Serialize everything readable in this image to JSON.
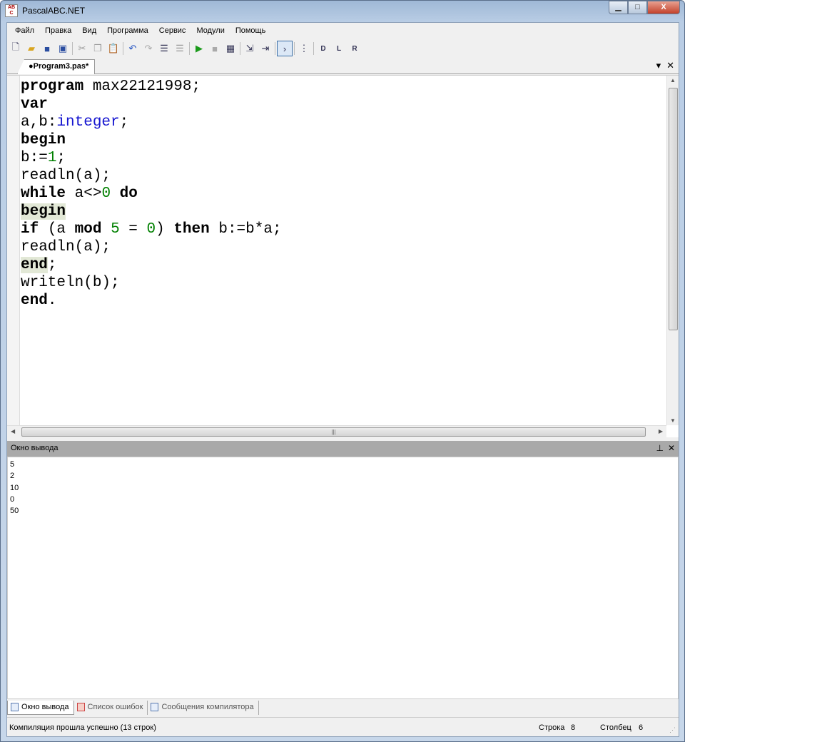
{
  "window": {
    "title": "PascalABC.NET",
    "min": "▁",
    "max": "□",
    "close": "X"
  },
  "menu": [
    "Файл",
    "Правка",
    "Вид",
    "Программа",
    "Сервис",
    "Модули",
    "Помощь"
  ],
  "tab": {
    "label": "●Program3.pas*",
    "dropdown": "▾",
    "close": "✕"
  },
  "code": [
    [
      [
        "program",
        "k"
      ],
      [
        " max22121998;",
        ""
      ]
    ],
    [
      [
        "var",
        "k"
      ]
    ],
    [
      [
        "a,b:",
        ""
      ],
      [
        "integer",
        "ty"
      ],
      [
        ";",
        ""
      ]
    ],
    [
      [
        "begin",
        "k"
      ]
    ],
    [
      [
        "b:=",
        ""
      ],
      [
        "1",
        "n"
      ],
      [
        ";",
        ""
      ]
    ],
    [
      [
        "readln(a);",
        ""
      ]
    ],
    [
      [
        "while",
        "k"
      ],
      [
        " a<>",
        ""
      ],
      [
        "0",
        "n"
      ],
      [
        " ",
        ""
      ],
      [
        "do",
        "k"
      ]
    ],
    [
      [
        "begin",
        "k hl"
      ]
    ],
    [
      [
        "if",
        "k"
      ],
      [
        " (a ",
        ""
      ],
      [
        "mod",
        "k"
      ],
      [
        " ",
        ""
      ],
      [
        "5",
        "n"
      ],
      [
        " = ",
        ""
      ],
      [
        "0",
        "n"
      ],
      [
        ") ",
        ""
      ],
      [
        "then",
        "k"
      ],
      [
        " b:=b*a;",
        ""
      ]
    ],
    [
      [
        "readln(a);",
        ""
      ]
    ],
    [
      [
        "end",
        "k hl"
      ],
      [
        ";",
        ""
      ]
    ],
    [
      [
        "writeln(b);",
        ""
      ]
    ],
    [
      [
        "end",
        "k"
      ],
      [
        ".",
        ""
      ]
    ]
  ],
  "output_panel": {
    "title": "Окно вывода",
    "pin": "⊥",
    "close": "✕",
    "lines": [
      "5",
      "2",
      "10",
      "0",
      "50"
    ]
  },
  "bottom_tabs": [
    "Окно вывода",
    "Список ошибок",
    "Сообщения компилятора"
  ],
  "status": {
    "message": "Компиляция прошла успешно (13 строк)",
    "row_label": "Строка",
    "row": "8",
    "col_label": "Столбец",
    "col": "6"
  }
}
